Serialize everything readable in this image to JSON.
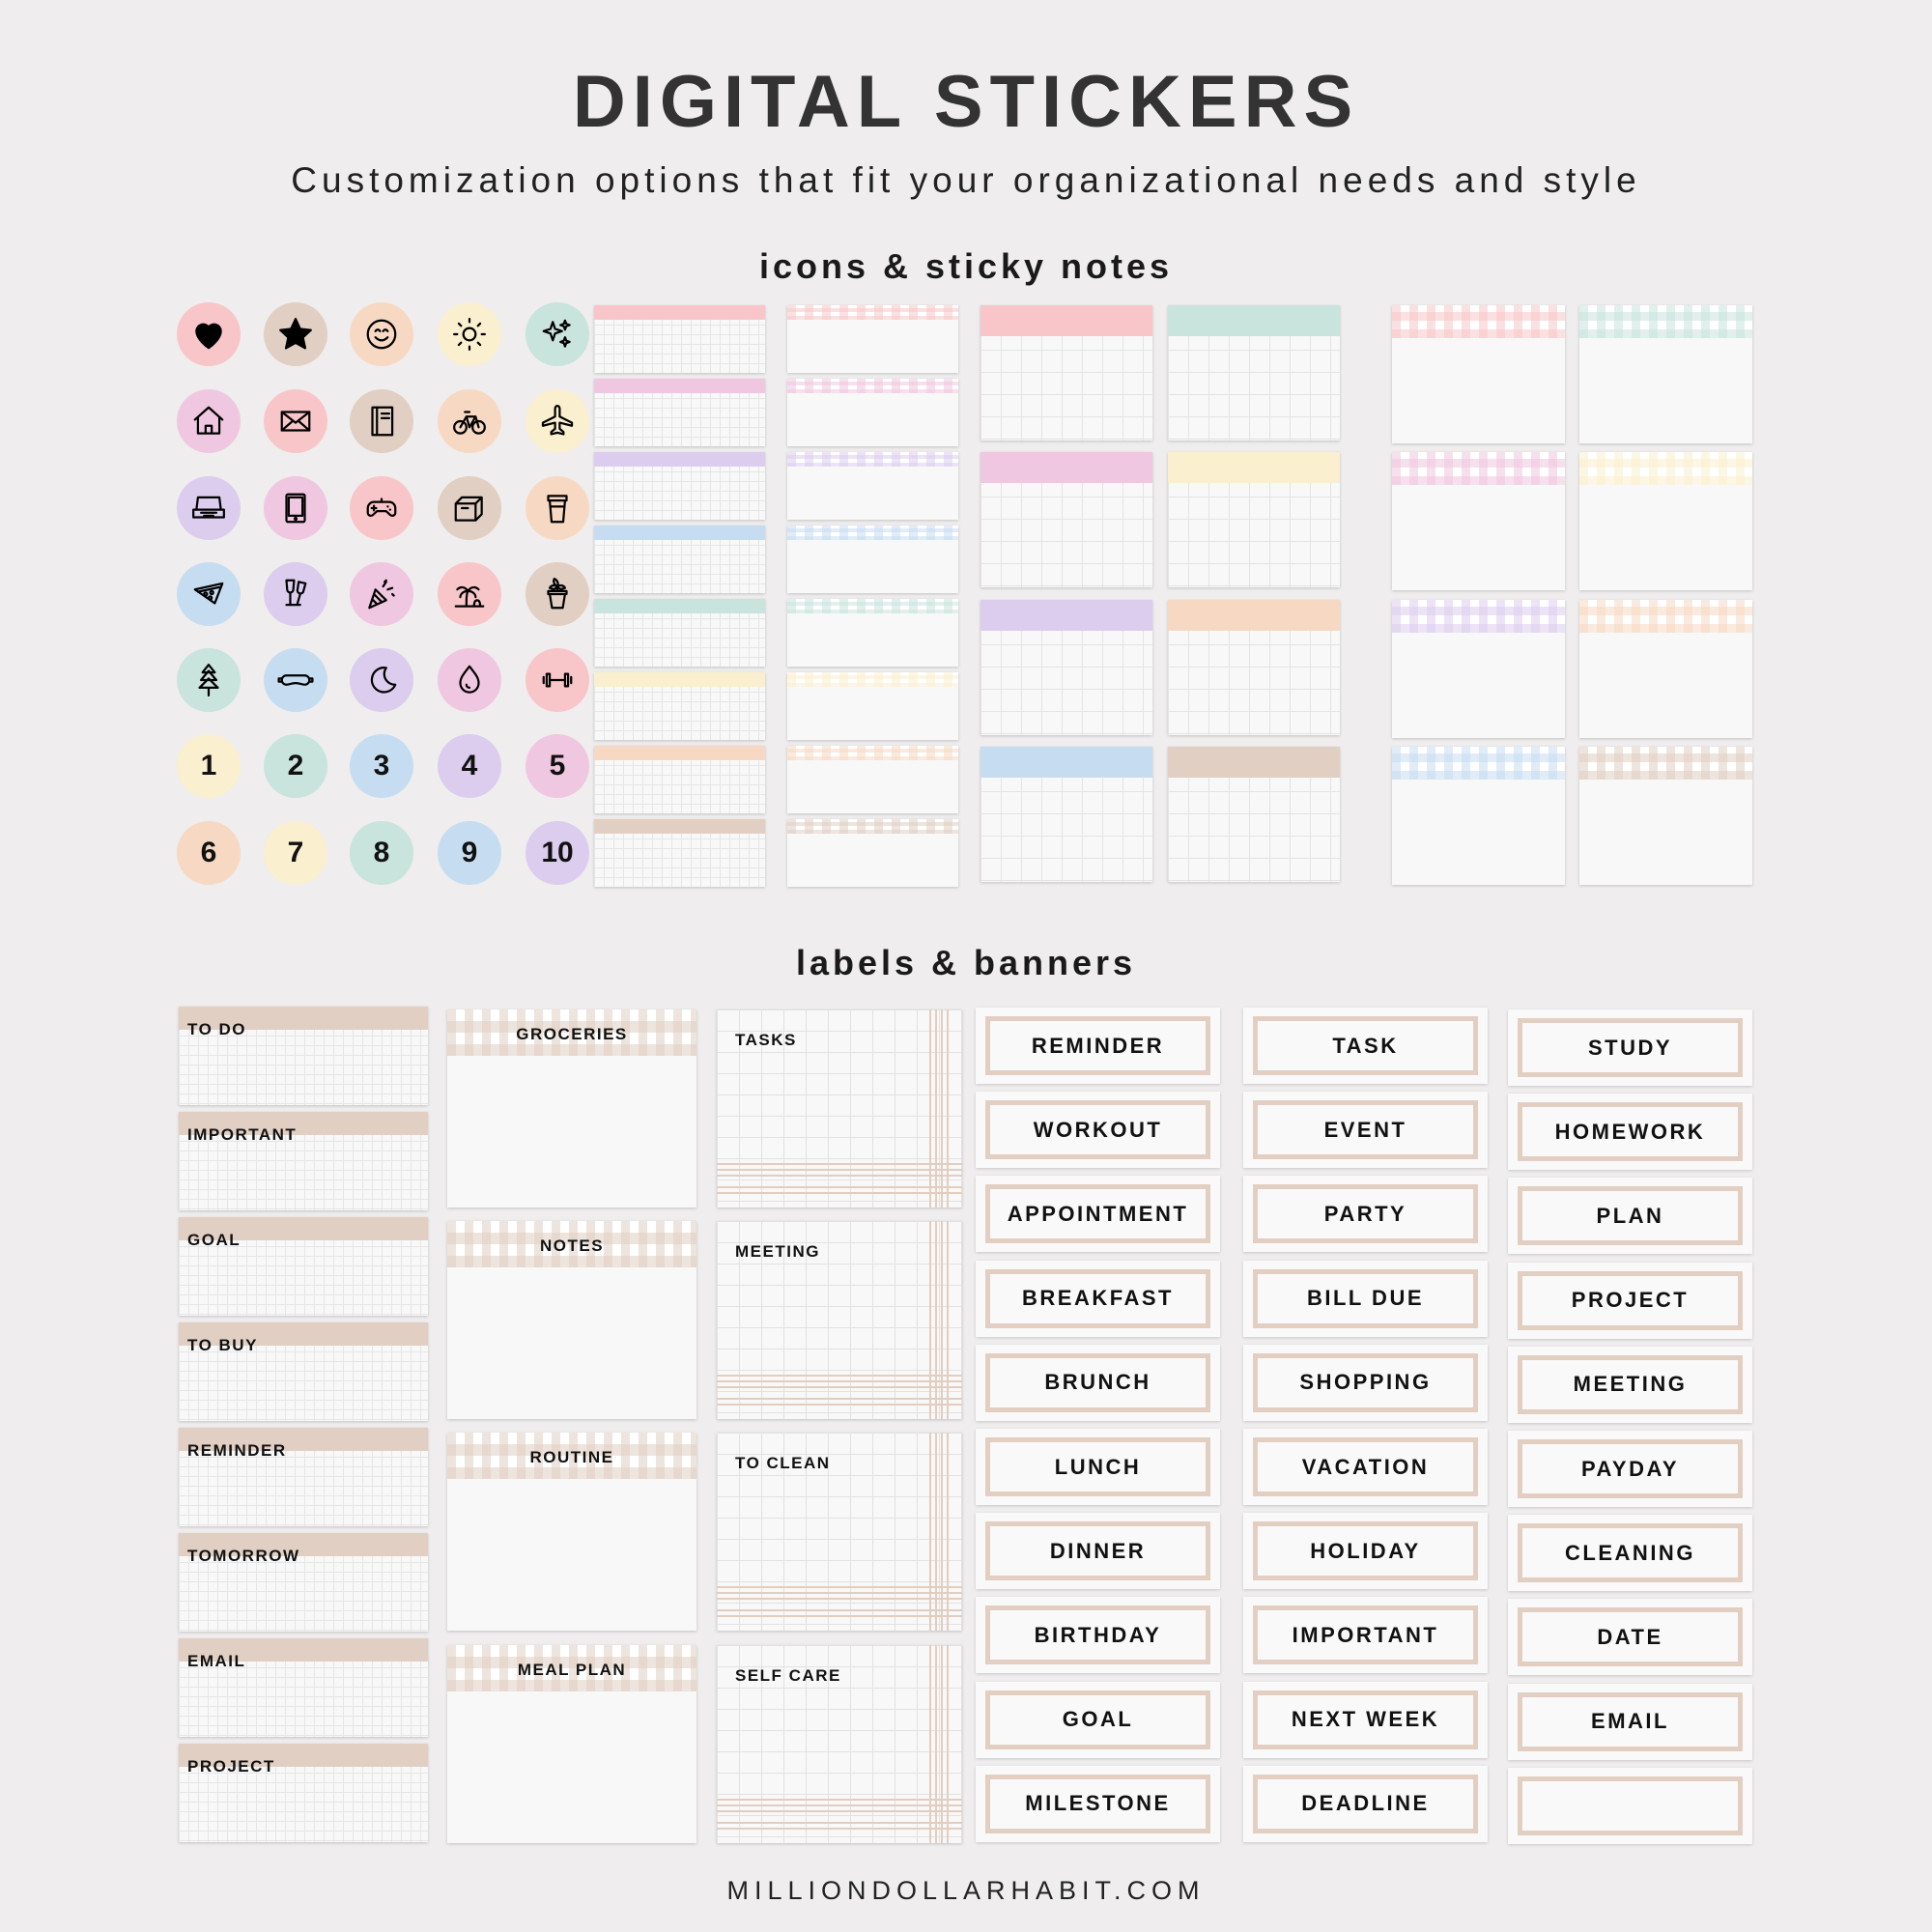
{
  "header": {
    "title": "DIGITAL STICKERS",
    "subtitle": "Customization options that fit your organizational needs and style"
  },
  "palette": {
    "pink": "#f8c6c9",
    "tan": "#e1cfc3",
    "peach": "#f7d9c3",
    "yellow": "#faefcf",
    "mint": "#c8e4dd",
    "rose": "#f0c7e0",
    "lavender": "#dccdee",
    "blue": "#c6ddf1",
    "banner_border": "#e3cfc2"
  },
  "icons_section": {
    "title": "icons & sticky notes",
    "icon_rows": [
      [
        {
          "icon": "heart",
          "color": "pink"
        },
        {
          "icon": "star",
          "color": "tan"
        },
        {
          "icon": "smile",
          "color": "peach"
        },
        {
          "icon": "sun",
          "color": "yellow"
        },
        {
          "icon": "sparkles",
          "color": "mint"
        }
      ],
      [
        {
          "icon": "home",
          "color": "rose"
        },
        {
          "icon": "mail",
          "color": "pink"
        },
        {
          "icon": "notebook",
          "color": "tan"
        },
        {
          "icon": "bicycle",
          "color": "peach"
        },
        {
          "icon": "airplane",
          "color": "yellow"
        }
      ],
      [
        {
          "icon": "laptop",
          "color": "lavender"
        },
        {
          "icon": "tablet",
          "color": "rose"
        },
        {
          "icon": "gamepad",
          "color": "pink"
        },
        {
          "icon": "box",
          "color": "tan"
        },
        {
          "icon": "coffee-cup",
          "color": "peach"
        }
      ],
      [
        {
          "icon": "pizza",
          "color": "blue"
        },
        {
          "icon": "champagne",
          "color": "lavender"
        },
        {
          "icon": "party-popper",
          "color": "rose"
        },
        {
          "icon": "palm-tree",
          "color": "pink"
        },
        {
          "icon": "plant",
          "color": "tan"
        }
      ],
      [
        {
          "icon": "tree",
          "color": "mint"
        },
        {
          "icon": "sleep-mask",
          "color": "blue"
        },
        {
          "icon": "moon",
          "color": "lavender"
        },
        {
          "icon": "droplet",
          "color": "rose"
        },
        {
          "icon": "dumbbell",
          "color": "pink"
        }
      ]
    ],
    "number_rows": [
      [
        {
          "label": "1",
          "color": "yellow"
        },
        {
          "label": "2",
          "color": "mint"
        },
        {
          "label": "3",
          "color": "blue"
        },
        {
          "label": "4",
          "color": "lavender"
        },
        {
          "label": "5",
          "color": "rose"
        }
      ],
      [
        {
          "label": "6",
          "color": "peach"
        },
        {
          "label": "7",
          "color": "yellow"
        },
        {
          "label": "8",
          "color": "mint"
        },
        {
          "label": "9",
          "color": "blue"
        },
        {
          "label": "10",
          "color": "lavender"
        }
      ]
    ],
    "small_grid_notes": [
      "pink",
      "rose",
      "lavender",
      "blue",
      "mint",
      "yellow",
      "peach",
      "tan"
    ],
    "small_gingham_notes": [
      "pink",
      "rose",
      "lavender",
      "blue",
      "mint",
      "yellow",
      "peach",
      "tan"
    ],
    "medium_grid_notes": [
      [
        "pink",
        "rose",
        "lavender",
        "blue"
      ],
      [
        "mint",
        "yellow",
        "peach",
        "tan"
      ]
    ],
    "medium_gingham_notes": [
      [
        "pink",
        "rose",
        "lavender",
        "blue"
      ],
      [
        "mint",
        "yellow",
        "peach",
        "tan"
      ]
    ]
  },
  "labels_section": {
    "title": "labels & banners",
    "header_labels": [
      "TO DO",
      "IMPORTANT",
      "GOAL",
      "TO BUY",
      "REMINDER",
      "TOMORROW",
      "EMAIL",
      "PROJECT"
    ],
    "gingham_labels": [
      "GROCERIES",
      "NOTES",
      "ROUTINE",
      "MEAL PLAN"
    ],
    "plaid_labels": [
      "TASKS",
      "MEETING",
      "TO CLEAN",
      "SELF CARE"
    ],
    "banner_columns": [
      [
        "REMINDER",
        "WORKOUT",
        "APPOINTMENT",
        "BREAKFAST",
        "BRUNCH",
        "LUNCH",
        "DINNER",
        "BIRTHDAY",
        "GOAL",
        "MILESTONE"
      ],
      [
        "TASK",
        "EVENT",
        "PARTY",
        "BILL DUE",
        "SHOPPING",
        "VACATION",
        "HOLIDAY",
        "IMPORTANT",
        "NEXT WEEK",
        "DEADLINE"
      ],
      [
        "STUDY",
        "HOMEWORK",
        "PLAN",
        "PROJECT",
        "MEETING",
        "PAYDAY",
        "CLEANING",
        "DATE",
        "EMAIL",
        ""
      ]
    ]
  },
  "footer": {
    "website": "MILLIONDOLLARHABIT.COM"
  }
}
